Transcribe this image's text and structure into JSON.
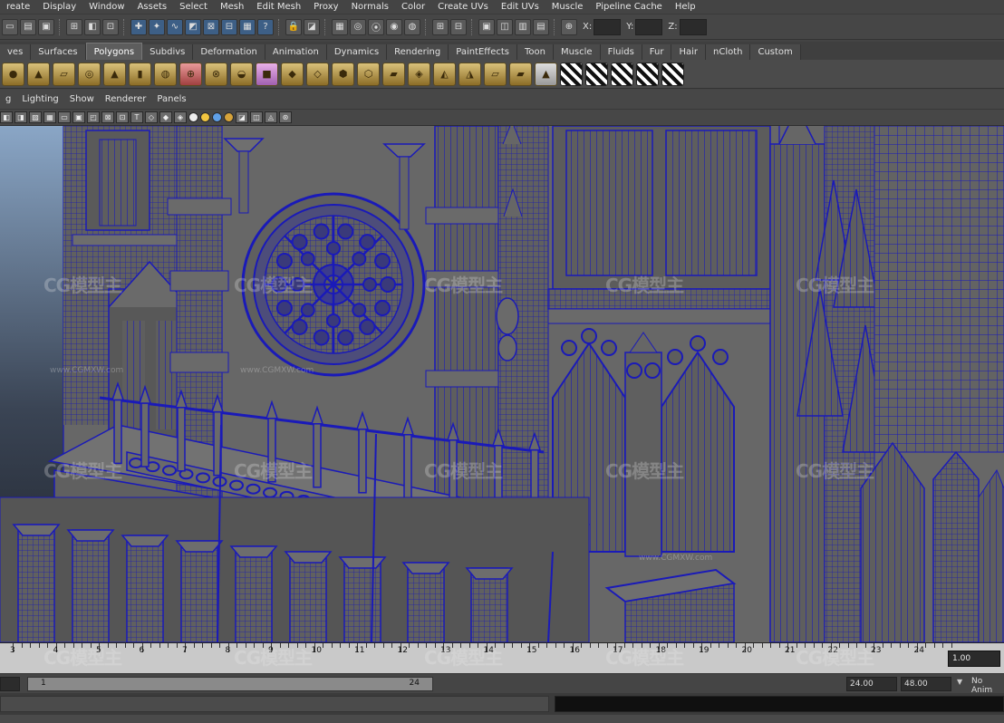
{
  "menubar": {
    "items": [
      "reate",
      "Display",
      "Window",
      "Assets",
      "Select",
      "Mesh",
      "Edit Mesh",
      "Proxy",
      "Normals",
      "Color",
      "Create UVs",
      "Edit UVs",
      "Muscle",
      "Pipeline Cache",
      "Help"
    ]
  },
  "statusline": {
    "x_label": "X:",
    "y_label": "Y:",
    "z_label": "Z:"
  },
  "shelf_tabs": {
    "items": [
      "ves",
      "Surfaces",
      "Polygons",
      "Subdivs",
      "Deformation",
      "Animation",
      "Dynamics",
      "Rendering",
      "PaintEffects",
      "Toon",
      "Muscle",
      "Fluids",
      "Fur",
      "Hair",
      "nCloth",
      "Custom"
    ],
    "active": "Polygons"
  },
  "panel_menu": {
    "items": [
      "g",
      "Lighting",
      "Show",
      "Renderer",
      "Panels"
    ]
  },
  "timeslider": {
    "ticks": [
      "3",
      "4",
      "5",
      "6",
      "7",
      "8",
      "9",
      "10",
      "11",
      "12",
      "13",
      "14",
      "15",
      "16",
      "17",
      "18",
      "19",
      "20",
      "21",
      "22",
      "23",
      "24"
    ],
    "current_frame": "1.00"
  },
  "range_slider": {
    "range_start_label": "1",
    "range_end_label": "24",
    "end_time": "24.00",
    "anim_end": "48.00",
    "anim_layer": "No Anim"
  },
  "watermark": {
    "brand": "CG模型主",
    "url": "www.CGMXW.com"
  },
  "colors": {
    "wire": "#1a1ab8",
    "mesh_gray": "#6b6b6b",
    "ui_bg": "#444444",
    "accent": "#3d5f86"
  }
}
